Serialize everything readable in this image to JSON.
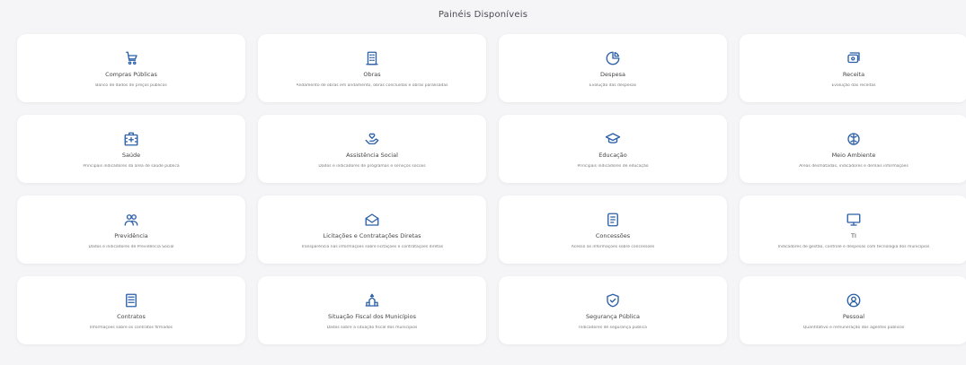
{
  "header": {
    "title": "Painéis Disponíveis"
  },
  "accent_color": "#2b5fa8",
  "cards": [
    {
      "title": "Compras Públicas",
      "desc": "Banco de dados de preços públicos",
      "icon": "cart-icon"
    },
    {
      "title": "Obras",
      "desc": "Andamento de obras em andamento, obras concluídas e obras paralisadas",
      "icon": "building-icon"
    },
    {
      "title": "Despesa",
      "desc": "Evolução das despesas",
      "icon": "pie-chart-icon"
    },
    {
      "title": "Receita",
      "desc": "Evolução das receitas",
      "icon": "money-icon"
    },
    {
      "title": "Saúde",
      "desc": "Principais indicadores da área de saúde pública",
      "icon": "hospital-icon"
    },
    {
      "title": "Assistência Social",
      "desc": "Dados e indicadores de programas e serviços sociais",
      "icon": "heart-hand-icon"
    },
    {
      "title": "Educação",
      "desc": "Principais indicadores de educação",
      "icon": "graduation-cap-icon"
    },
    {
      "title": "Meio Ambiente",
      "desc": "Áreas desmatadas, indicadores e demais informações",
      "icon": "leaf-icon"
    },
    {
      "title": "Previdência",
      "desc": "Dados e indicadores de Previdência Social",
      "icon": "people-icon"
    },
    {
      "title": "Licitações e Contratações Diretas",
      "desc": "Transparência nas informações sobre licitações e contratações diretas",
      "icon": "envelope-icon"
    },
    {
      "title": "Concessões",
      "desc": "Acesso às informações sobre concessões",
      "icon": "clipboard-icon"
    },
    {
      "title": "TI",
      "desc": "Indicadores de gestão, controle e despesas com tecnologia dos municípios",
      "icon": "monitor-icon"
    },
    {
      "title": "Contratos",
      "desc": "Informações sobre os contratos firmados",
      "icon": "document-icon"
    },
    {
      "title": "Situação Fiscal dos Municípios",
      "desc": "Dados sobre a situação fiscal dos municípios",
      "icon": "bank-icon"
    },
    {
      "title": "Segurança Pública",
      "desc": "Indicadores de segurança pública",
      "icon": "shield-check-icon"
    },
    {
      "title": "Pessoal",
      "desc": "Quantitativo e remuneração dos agentes públicos",
      "icon": "user-circle-icon"
    }
  ]
}
